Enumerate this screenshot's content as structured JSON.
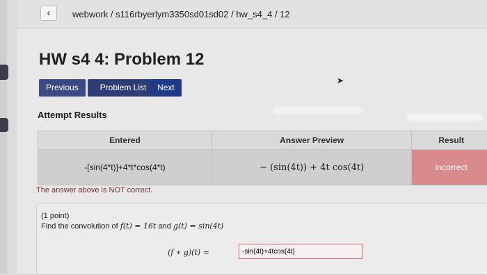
{
  "breadcrumb": "webwork / s116rbyerlym3350sd01sd02 / hw_s4_4 / 12",
  "back_icon": "‹",
  "page_title": "HW s4 4: Problem 12",
  "nav": {
    "previous": "Previous",
    "problem_list": "Problem List",
    "next": "Next"
  },
  "attempt_results": {
    "heading": "Attempt Results",
    "columns": [
      "Entered",
      "Answer Preview",
      "Result"
    ],
    "row": {
      "entered": "-[sin(4*t)]+4*t*cos(4*t)",
      "preview": "− (sin(4t)) + 4t cos(4t)",
      "result": "incorrect"
    }
  },
  "status_message": "The answer above is NOT correct.",
  "problem": {
    "points": "(1 point)",
    "statement_prefix": "Find the convolution of ",
    "f_def": "f(t) = 16t",
    "and_text": " and ",
    "g_def": "g(t) = sin(4t)",
    "answer_label": "(f ∗ g)(t) =",
    "answer_value": "-sin(4t)+4tcos(4t)"
  },
  "colors": {
    "button_bg": "#2f3d74",
    "incorrect_bg": "#d98a8a",
    "input_border": "#cc6a6a"
  }
}
